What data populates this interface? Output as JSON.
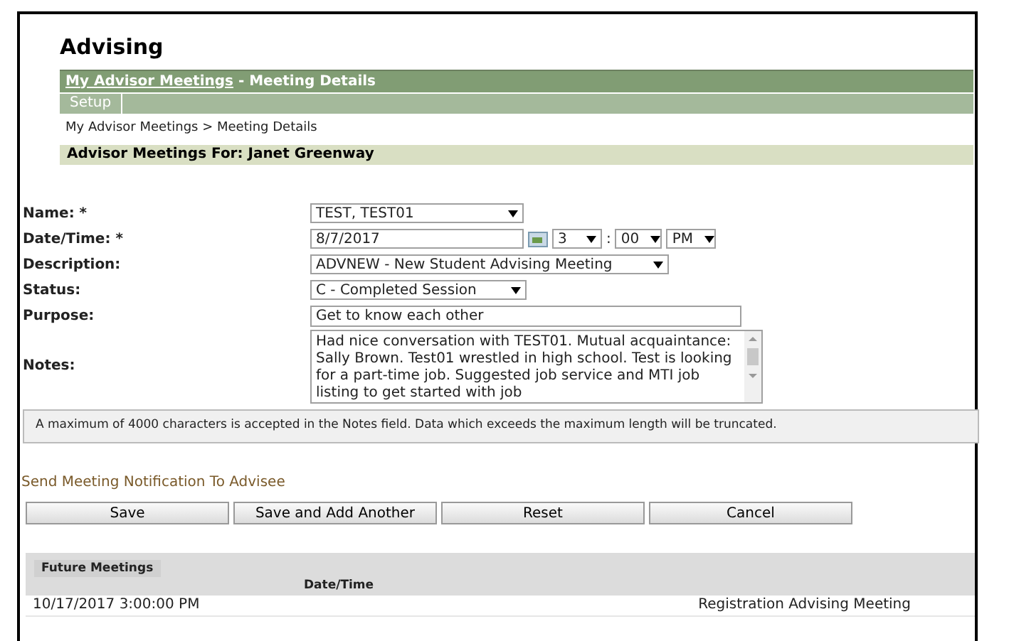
{
  "page_title": "Advising",
  "header": {
    "link": "My Advisor Meetings",
    "title": " - Meeting Details"
  },
  "tabs": [
    {
      "label": "Setup",
      "selected": true
    }
  ],
  "breadcrumb": "My Advisor Meetings > Meeting Details",
  "section_title": "Advisor Meetings For: Janet Greenway",
  "form": {
    "name": {
      "label": "Name: *",
      "value": "TEST, TEST01"
    },
    "datetime": {
      "label": "Date/Time: *",
      "date": "8/7/2017",
      "hour": "3",
      "separator": ":",
      "minute": "00",
      "ampm": "PM"
    },
    "description": {
      "label": "Description:",
      "value": "ADVNEW - New Student Advising Meeting"
    },
    "status": {
      "label": "Status:",
      "value": "C - Completed Session"
    },
    "purpose": {
      "label": "Purpose:",
      "value": "Get to know each other"
    },
    "notes": {
      "label": "Notes:",
      "value": "Had nice conversation with TEST01.  Mutual acquaintance: Sally Brown.  Test01 wrestled in high school.  Test is looking for a part-time job.  Suggested job service and MTI job listing to get started with job"
    }
  },
  "notice": "A maximum of 4000 characters is accepted in the Notes field. Data which exceeds the maximum length will be truncated.",
  "notification_link": "Send Meeting Notification To Advisee",
  "buttons": [
    "Save",
    "Save and Add Another",
    "Reset",
    "Cancel"
  ],
  "future_meetings": {
    "title": "Future Meetings",
    "columns": [
      "Date/Time"
    ],
    "rows": [
      {
        "date_time": "10/17/2017 3:00:00 PM",
        "column_2": "Registration Advising Meeting"
      }
    ]
  }
}
